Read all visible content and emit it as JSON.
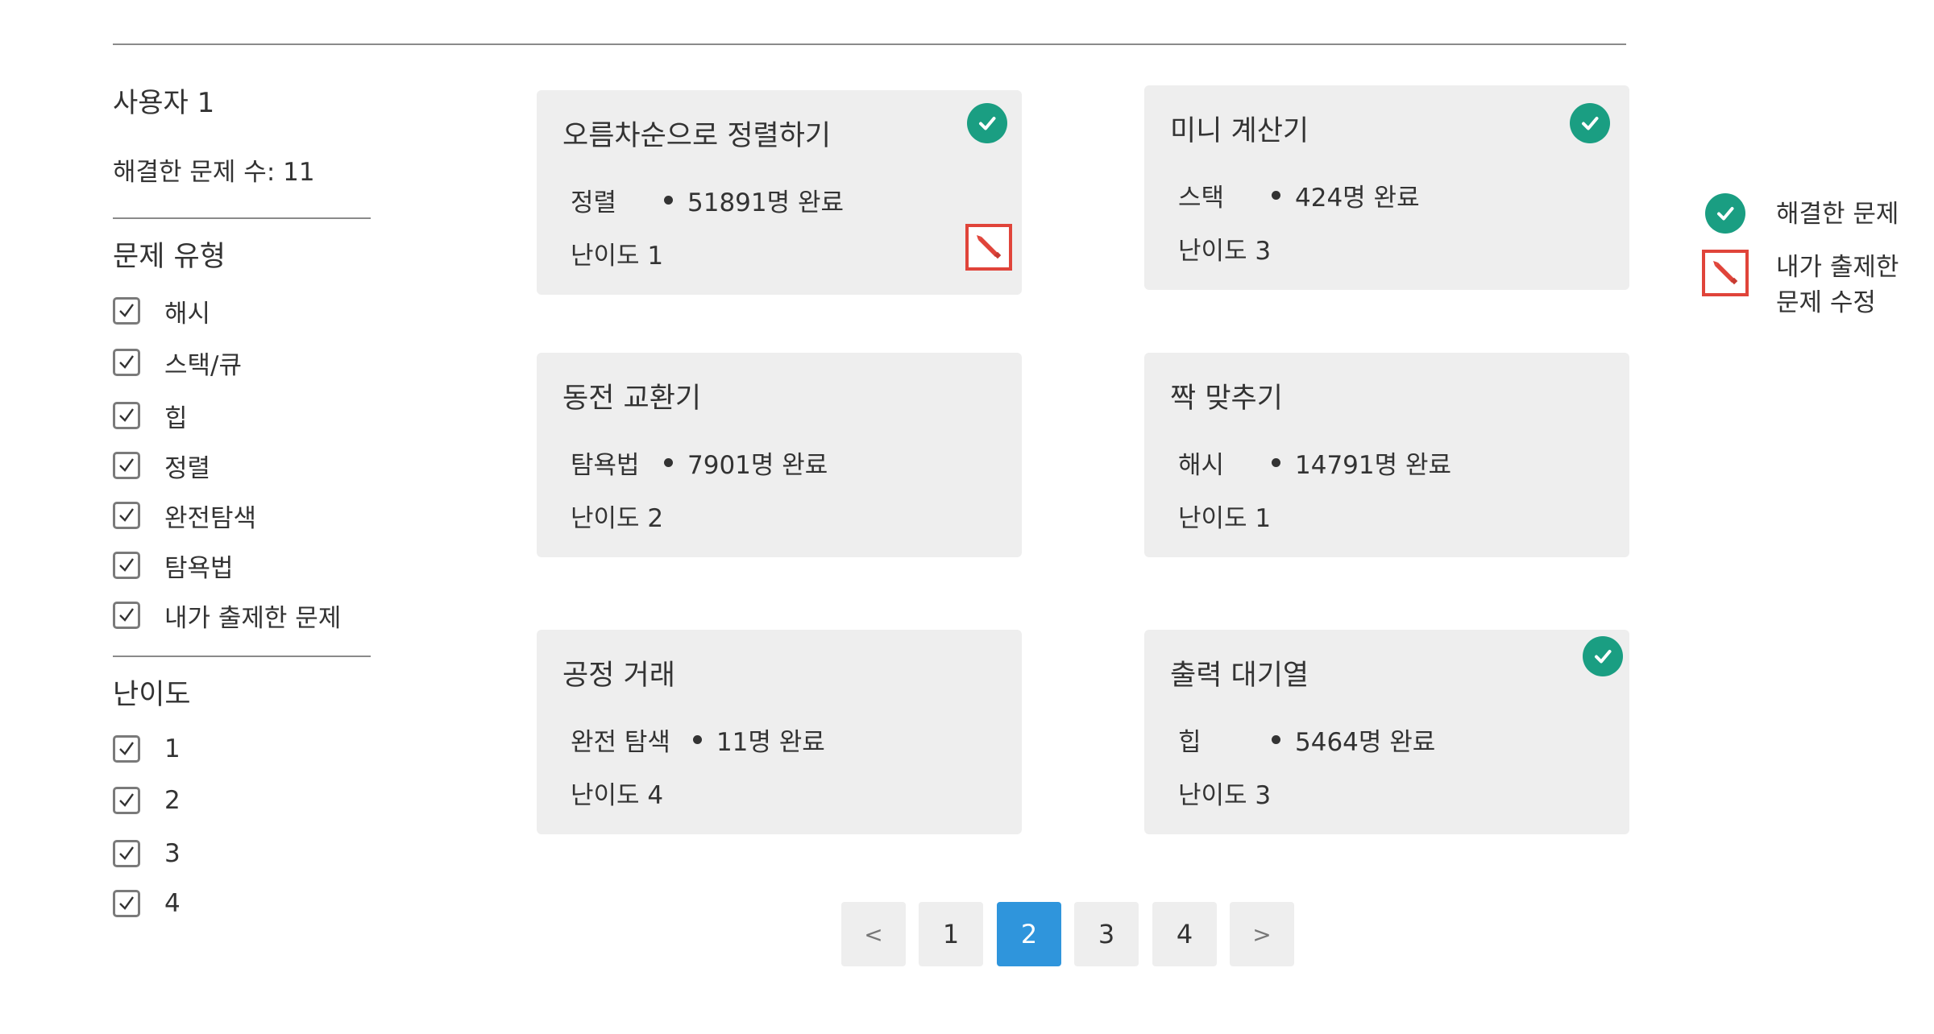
{
  "sidebar": {
    "user_name": "사용자 1",
    "solved_count": "해결한 문제 수: 11",
    "type_section_title": "문제 유형",
    "type_filters": [
      {
        "label": "해시",
        "checked": true
      },
      {
        "label": "스택/큐",
        "checked": true
      },
      {
        "label": "힙",
        "checked": true
      },
      {
        "label": "정렬",
        "checked": true
      },
      {
        "label": "완전탐색",
        "checked": true
      },
      {
        "label": "탐욕법",
        "checked": true
      },
      {
        "label": "내가 출제한 문제",
        "checked": true
      }
    ],
    "level_section_title": "난이도",
    "level_filters": [
      {
        "label": "1",
        "checked": true
      },
      {
        "label": "2",
        "checked": true
      },
      {
        "label": "3",
        "checked": true
      },
      {
        "label": "4",
        "checked": true
      }
    ]
  },
  "cards": [
    {
      "title": "오름차순으로 정렬하기",
      "type": "정렬",
      "completed": "51891명 완료",
      "level": "난이도 1",
      "solved": true,
      "editable": true
    },
    {
      "title": "미니 계산기",
      "type": "스택",
      "completed": "424명 완료",
      "level": "난이도 3",
      "solved": true,
      "editable": false
    },
    {
      "title": "동전 교환기",
      "type": "탐욕법",
      "completed": "7901명 완료",
      "level": "난이도 2",
      "solved": false,
      "editable": false
    },
    {
      "title": "짝 맞추기",
      "type": "해시",
      "completed": "14791명 완료",
      "level": "난이도 1",
      "solved": false,
      "editable": false
    },
    {
      "title": "공정 거래",
      "type": "완전 탐색",
      "completed": "11명 완료",
      "level": "난이도 4",
      "solved": false,
      "editable": false
    },
    {
      "title": "출력 대기열",
      "type": "힙",
      "completed": "5464명 완료",
      "level": "난이도 3",
      "solved": true,
      "editable": false
    }
  ],
  "pagination": {
    "prev": "<",
    "pages": [
      "1",
      "2",
      "3",
      "4"
    ],
    "current": "2",
    "next": ">"
  },
  "legend": {
    "solved": "해결한 문제",
    "edit_line1": "내가 출제한",
    "edit_line2": "문제 수정"
  },
  "colors": {
    "solved_badge": "#1a9e82",
    "edit_badge": "#e0443a",
    "active_page": "#2f95dc",
    "card_bg": "#eeeeee"
  },
  "icons": {
    "solved": "check-circle-icon",
    "edit": "pencil-icon",
    "checkbox": "checkbox-checked-icon"
  }
}
